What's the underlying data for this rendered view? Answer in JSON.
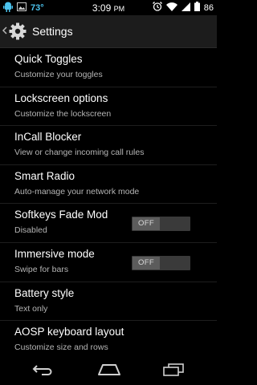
{
  "status_bar": {
    "temperature": "73°",
    "time": "3:09",
    "ampm": "PM",
    "battery": "86",
    "icons": [
      "android-logo-icon",
      "image-notification-icon",
      "alarm-icon",
      "wifi-icon",
      "signal-icon",
      "battery-icon"
    ]
  },
  "action_bar": {
    "title": "Settings",
    "icons": [
      "chevron-left-icon",
      "gear-icon"
    ]
  },
  "settings": [
    {
      "title": "Quick Toggles",
      "summary": "Customize your toggles"
    },
    {
      "title": "Lockscreen options",
      "summary": "Customize the lockscreen"
    },
    {
      "title": "InCall Blocker",
      "summary": "View or change incoming call rules"
    },
    {
      "title": "Smart Radio",
      "summary": "Auto-manage your network mode"
    },
    {
      "title": "Softkeys Fade Mod",
      "summary": "Disabled",
      "toggle": "OFF"
    },
    {
      "title": "Immersive mode",
      "summary": "Swipe for bars",
      "toggle": "OFF"
    },
    {
      "title": "Battery style",
      "summary": "Text only"
    },
    {
      "title": "AOSP keyboard layout",
      "summary": "Customize size and rows"
    }
  ],
  "nav_bar": {
    "icons": [
      "back-icon",
      "home-icon",
      "recents-icon"
    ]
  }
}
